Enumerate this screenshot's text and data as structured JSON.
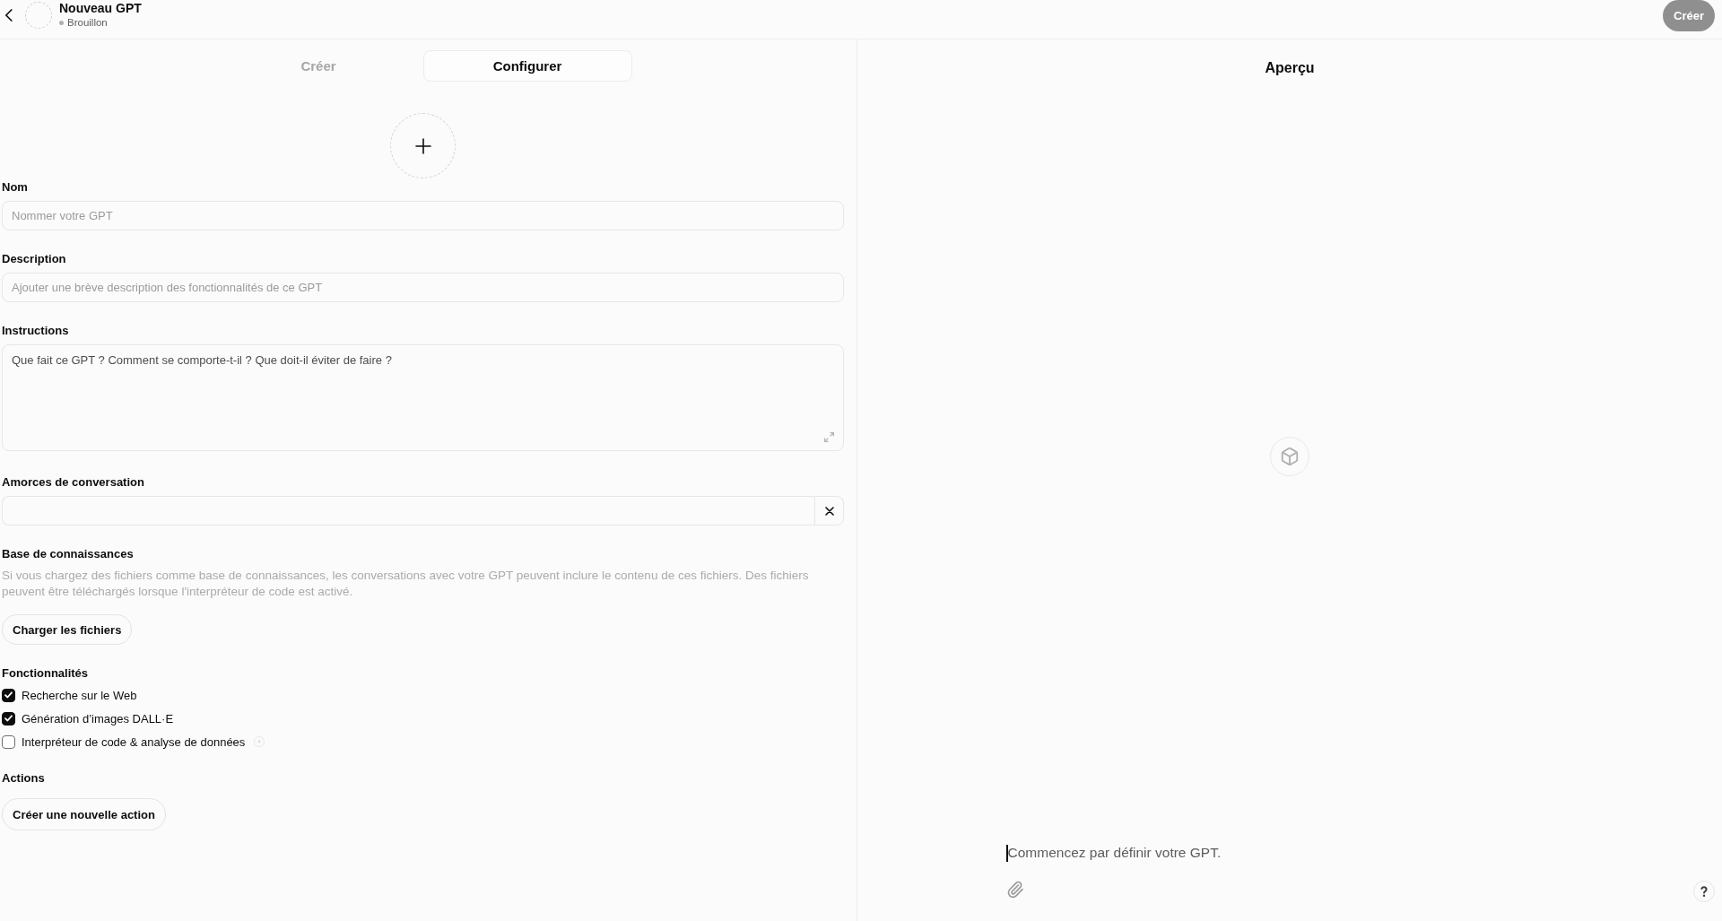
{
  "header": {
    "title": "Nouveau GPT",
    "status": "Brouillon",
    "create_button": {
      "label": "Créer",
      "disabled": true
    }
  },
  "tabs": [
    {
      "label": "Créer",
      "selected": false
    },
    {
      "label": "Configurer",
      "selected": true
    }
  ],
  "fields": [
    {
      "kind": "input",
      "label": "Nom",
      "placeholder": "Nommer votre GPT"
    },
    {
      "kind": "input",
      "label": "Description",
      "placeholder": "Ajouter une brève description des fonctionnalités de ce GPT"
    },
    {
      "kind": "textarea",
      "label": "Instructions",
      "placeholder": "Que fait ce GPT ? Comment se comporte-t-il ? Que doit-il éviter de faire ?"
    },
    {
      "kind": "starters",
      "label": "Amorces de conversation"
    }
  ],
  "knowledge": {
    "label": "Base de connaissances",
    "description": "Si vous chargez des fichiers comme base de connaissances, les conversations avec votre GPT peuvent inclure le contenu de ces fichiers. Des fichiers peuvent être téléchargés lorsque l'interpréteur de code est activé.",
    "upload_button": "Charger les fichiers"
  },
  "capabilities": {
    "label": "Fonctionnalités",
    "items": [
      {
        "label": "Recherche sur le Web",
        "checked": true,
        "help": false
      },
      {
        "label": "Génération d’images DALL·E",
        "checked": true,
        "help": false
      },
      {
        "label": "Interpréteur de code & analyse de données",
        "checked": false,
        "help": true
      }
    ]
  },
  "actions": {
    "label": "Actions",
    "button": "Créer une nouvelle action"
  },
  "preview": {
    "title": "Aperçu",
    "composer": {
      "placeholder": "Commencez par définir votre GPT."
    }
  }
}
